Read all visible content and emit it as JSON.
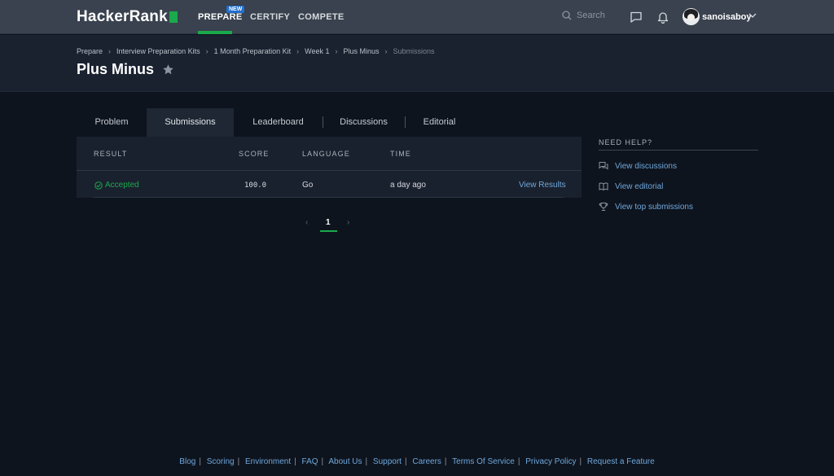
{
  "nav": {
    "logo": "HackerRank",
    "prepare": "PREPARE",
    "new_badge": "NEW",
    "certify": "CERTIFY",
    "compete": "COMPETE",
    "search_placeholder": "Search",
    "username": "sanoisaboy",
    "accent_color": "#1ba94c"
  },
  "breadcrumb": [
    "Prepare",
    "Interview Preparation Kits",
    "1 Month Preparation Kit",
    "Week 1",
    "Plus Minus",
    "Submissions"
  ],
  "page_title": "Plus Minus",
  "tabs": [
    "Problem",
    "Submissions",
    "Leaderboard",
    "Discussions",
    "Editorial"
  ],
  "active_tab": "Submissions",
  "table": {
    "headers": [
      "RESULT",
      "SCORE",
      "LANGUAGE",
      "TIME"
    ],
    "rows": [
      {
        "result": "Accepted",
        "score": "100.0",
        "language": "Go",
        "time": "a day ago",
        "action": "View Results"
      }
    ]
  },
  "pagination": {
    "current": "1",
    "prev": "‹",
    "next": "›"
  },
  "help": {
    "title": "NEED HELP?",
    "links": [
      "View discussions",
      "View editorial",
      "View top submissions"
    ]
  },
  "footer": [
    "Blog",
    "Scoring",
    "Environment",
    "FAQ",
    "About Us",
    "Support",
    "Careers",
    "Terms Of Service",
    "Privacy Policy",
    "Request a Feature"
  ]
}
